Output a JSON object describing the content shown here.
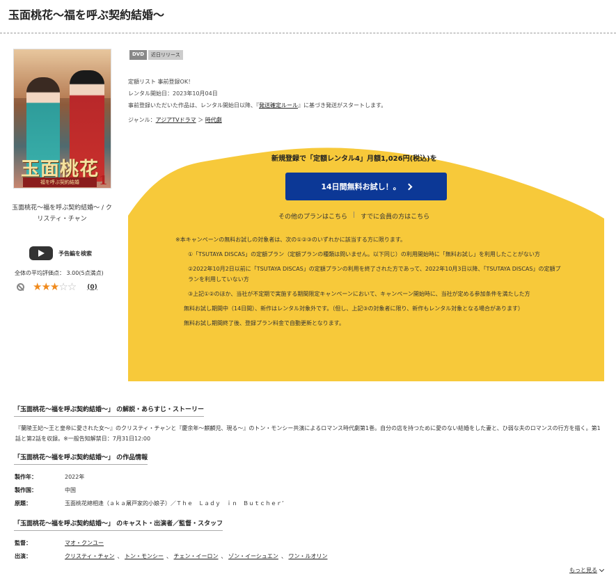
{
  "title": "玉面桃花〜福を呼ぶ契約結婚〜",
  "cover": {
    "logo_text": "玉面桃花",
    "logo_sub": "福を呼ぶ契約結婚",
    "volume": "1",
    "caption": "玉面桃花〜福を呼ぶ契約結婚〜 / クリスティ・チャン"
  },
  "trailer": {
    "label": "予告編を検索"
  },
  "rating": {
    "label": "全体の平均評価点： 3.00(5点満点)",
    "value": 3,
    "max": 5,
    "stars_on": "★★★",
    "stars_off": "☆☆",
    "count": "(0)"
  },
  "tags": {
    "format": "DVD",
    "status": "近日リリース"
  },
  "info": {
    "line1": "定額リスト 事前登録OK！",
    "line2": "レンタル開始日：2023年10月04日",
    "line3_prefix": "事前登録いただいた作品は、レンタル開始日以降、『",
    "line3_link": "発送確定ルール",
    "line3_suffix": "』に基づき発送がスタートします。",
    "genre_label": "ジャンル：",
    "genre1": "アジアTVドラマ",
    "genre_sep": "＞",
    "genre2": "時代劇"
  },
  "promo": {
    "headline": "新規登録で「定額レンタル4」月額1,026円(税込)を",
    "cta": "14日間無料お試し！。",
    "other_plans": "その他のプランはこちら",
    "separator": "|",
    "members": "すでに会員の方はこちら",
    "terms_intro": "※本キャンペーンの無料お試しの対象者は、次の①②③のいずれかに該当する方に限ります。",
    "term1": "①「TSUTAYA DISCAS」の定額プラン（定額プランの種類は問いません。以下同じ）の利用開始時に「無料お試し」を利用したことがない方",
    "term2": "②2022年10月2日以前に「TSUTAYA DISCAS」の定額プランの利用を終了された方であって、2022年10月3日以降、「TSUTAYA DISCAS」の定額プランを利用していない方",
    "term3": "③上記①②のほか、当社が不定期で実施する期間限定キャンペーンにおいて、キャンペーン開始時に、当社が定める参加条件を満たした方",
    "note1": "無料お試し期間中（14日間）、新作はレンタル対象外です。（但し、上記③の対象者に限り、新作もレンタル対象となる場合があります）",
    "note2": "無料お試し期間終了後、登録プラン料金で自動更新となります。"
  },
  "synopsis": {
    "heading": "「玉面桃花〜福を呼ぶ契約結婚〜」 の解説・あらすじ・ストーリー",
    "text": "『蘭陵王妃〜王と皇帝に愛された女〜』のクリスティ・チャンと『慶余年〜麒麟児、現る〜』のトン・モンシー共演によるロマンス時代劇第1巻。自分の店を持つために愛のない結婚をした妻と、ひ弱な夫のロマンスの行方を描く。第1話と第2話を収録。※一般告知解禁日：7月31日12:00"
  },
  "work_info": {
    "heading": "「玉面桃花〜福を呼ぶ契約結婚〜」 の作品情報",
    "year_label": "製作年：",
    "year": "2022年",
    "country_label": "製作国：",
    "country": "中国",
    "original_label": "原題：",
    "original": "玉面桃花總相逢（ａｋａ屠戸家的小娘子）／Ｔｈｅ　Ｌａｄｙ　ｉｎ　Ｂｕｔｃｈｅｒ’"
  },
  "cast": {
    "heading": "「玉面桃花〜福を呼ぶ契約結婚〜」 のキャスト・出演者／監督・スタッフ",
    "director_label": "監督：",
    "director": "マオ・クンユー",
    "cast_label": "出演：",
    "members": [
      "クリスティ・チャン",
      "トン・モンシー",
      "チェン・イーロン",
      "ゾン・イーシュエン",
      "ワン・ルオリン"
    ],
    "sep": "、"
  },
  "more": "もっと見る",
  "colors": {
    "promo_yellow": "#f7c93a",
    "cta_blue": "#0c3896",
    "star": "#f08a1c"
  }
}
